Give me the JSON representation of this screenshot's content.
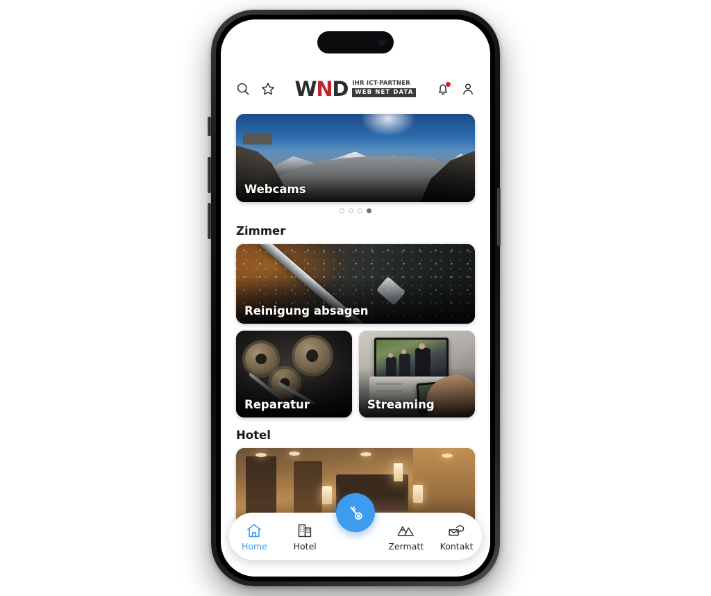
{
  "device": {
    "kind": "smartphone-mockup",
    "island": "dynamic-island"
  },
  "header": {
    "search_icon": "search-icon",
    "favorites_icon": "star-icon",
    "notifications_icon": "bell-icon",
    "account_icon": "person-icon",
    "has_notification_badge": true,
    "logo": {
      "mark_part1": "W",
      "mark_part2": "N",
      "mark_part3": "D",
      "tagline_top": "IHR ICT-PARTNER",
      "tagline_bottom": "WEB NET DATA"
    }
  },
  "hero": {
    "label": "Webcams",
    "image": "alpine-panorama-glacier",
    "dots_total": 4,
    "dots_active_index": 3
  },
  "sections": [
    {
      "title": "Zimmer",
      "wide_card": {
        "label": "Reinigung absagen",
        "image": "window-squeegee-cleaning"
      },
      "cards": [
        {
          "label": "Reparatur",
          "image": "gears-and-wrenches"
        },
        {
          "label": "Streaming",
          "image": "tv-with-phone-casting"
        }
      ]
    },
    {
      "title": "Hotel",
      "wide_card": {
        "label": "",
        "image": "hotel-room-interior"
      }
    }
  ],
  "bottom_nav": {
    "items": [
      {
        "label": "Home",
        "icon": "home-icon",
        "active": true
      },
      {
        "label": "Hotel",
        "icon": "building-icon",
        "active": false
      },
      {
        "label": "Zermatt",
        "icon": "mountains-icon",
        "active": false
      },
      {
        "label": "Kontakt",
        "icon": "contact-envelope-phone-icon",
        "active": false
      }
    ],
    "fab": {
      "icon": "key-icon"
    }
  },
  "colors": {
    "accent_blue": "#3d9bf0",
    "logo_red": "#c0232b",
    "logo_dark": "#2b2b2b",
    "badge_red": "#cc2222",
    "text_dark": "#1a1a1a",
    "page_background": "#ffffff"
  }
}
